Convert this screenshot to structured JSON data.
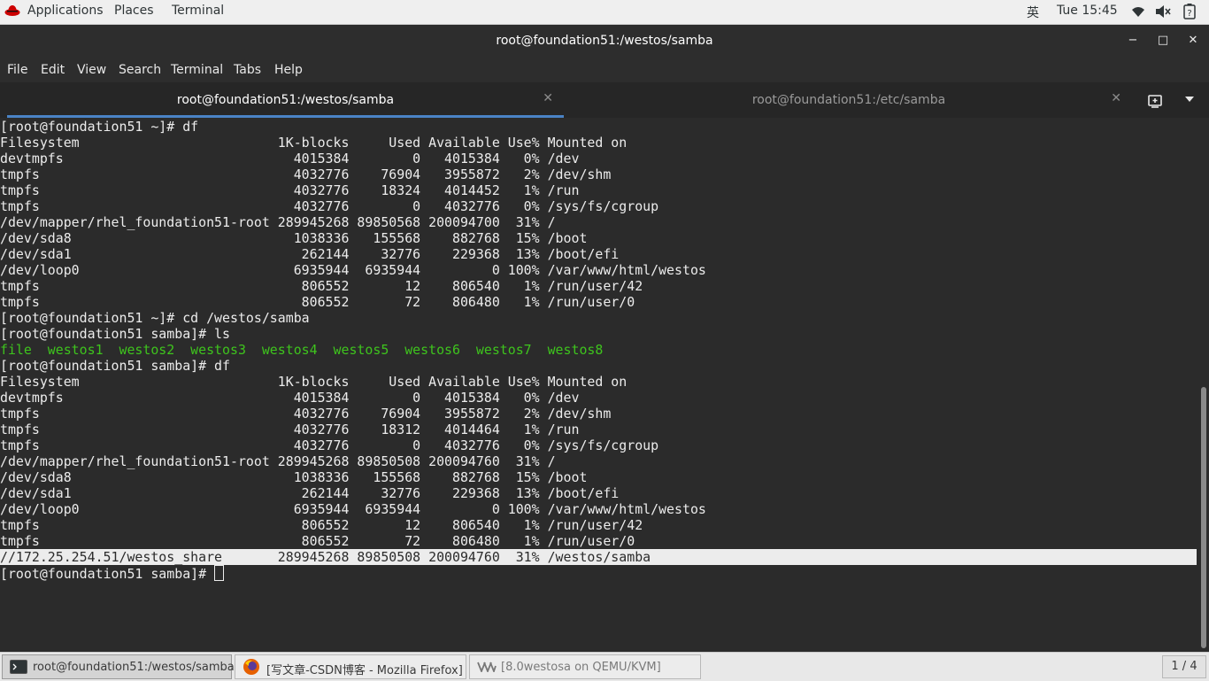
{
  "topbar": {
    "applications": "Applications",
    "places": "Places",
    "terminal": "Terminal",
    "input_method": "英",
    "clock": "Tue 15:45"
  },
  "window": {
    "title": "root@foundation51:/westos/samba",
    "minimize": "−",
    "maximize": "□",
    "close": "✕"
  },
  "menubar": [
    "File",
    "Edit",
    "View",
    "Search",
    "Terminal",
    "Tabs",
    "Help"
  ],
  "tabs": [
    {
      "label": "root@foundation51:/westos/samba",
      "active": true
    },
    {
      "label": "root@foundation51:/etc/samba",
      "active": false
    }
  ],
  "terminal": {
    "lines": [
      "[root@foundation51 ~]# df",
      "Filesystem                         1K-blocks     Used Available Use% Mounted on",
      "devtmpfs                             4015384        0   4015384   0% /dev",
      "tmpfs                                4032776    76904   3955872   2% /dev/shm",
      "tmpfs                                4032776    18324   4014452   1% /run",
      "tmpfs                                4032776        0   4032776   0% /sys/fs/cgroup",
      "/dev/mapper/rhel_foundation51-root 289945268 89850568 200094700  31% /",
      "/dev/sda8                            1038336   155568    882768  15% /boot",
      "/dev/sda1                             262144    32776    229368  13% /boot/efi",
      "/dev/loop0                           6935944  6935944         0 100% /var/www/html/westos",
      "tmpfs                                 806552       12    806540   1% /run/user/42",
      "tmpfs                                 806552       72    806480   1% /run/user/0",
      "[root@foundation51 ~]# cd /westos/samba",
      "[root@foundation51 samba]# ls",
      "file  westos1  westos2  westos3  westos4  westos5  westos6  westos7  westos8",
      "[root@foundation51 samba]# df",
      "Filesystem                         1K-blocks     Used Available Use% Mounted on",
      "devtmpfs                             4015384        0   4015384   0% /dev",
      "tmpfs                                4032776    76904   3955872   2% /dev/shm",
      "tmpfs                                4032776    18312   4014464   1% /run",
      "tmpfs                                4032776        0   4032776   0% /sys/fs/cgroup",
      "/dev/mapper/rhel_foundation51-root 289945268 89850508 200094760  31% /",
      "/dev/sda8                            1038336   155568    882768  15% /boot",
      "/dev/sda1                             262144    32776    229368  13% /boot/efi",
      "/dev/loop0                           6935944  6935944         0 100% /var/www/html/westos",
      "tmpfs                                 806552       12    806540   1% /run/user/42",
      "tmpfs                                 806552       72    806480   1% /run/user/0",
      "//172.25.254.51/westos_share       289945268 89850508 200094760  31% /westos/samba",
      "[root@foundation51 samba]# "
    ],
    "green_line_index": 14,
    "highlight_line_index": 27,
    "colors": {
      "background": "#2b2b2b",
      "foreground": "#ececec",
      "ls_green": "#3ec41d",
      "tab_accent": "#4a83c5"
    }
  },
  "taskbar": {
    "tasks": [
      {
        "label": "root@foundation51:/westos/samba",
        "icon": "terminal-icon"
      },
      {
        "label": "[写文章-CSDN博客 - Mozilla Firefox]",
        "icon": "firefox-icon"
      },
      {
        "label": "[8.0westosa on QEMU/KVM]",
        "icon": "virt-manager-icon"
      }
    ],
    "workspace": "1 / 4"
  }
}
